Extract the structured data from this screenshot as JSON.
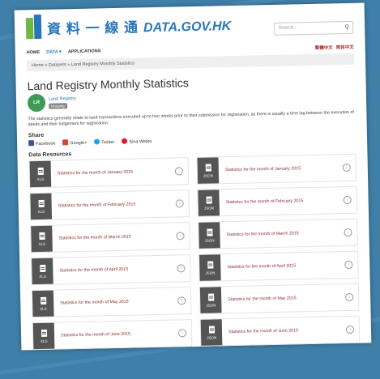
{
  "header": {
    "logo_chinese": "資 料 一 線 通",
    "logo_domain": "DATA.GOV.HK",
    "search_placeholder": "Search..."
  },
  "nav": {
    "items": [
      "HOME",
      "DATA ▾",
      "APPLICATIONS"
    ],
    "languages": [
      "繁體中文",
      "简体中文"
    ]
  },
  "breadcrumb": "Home » Datasets » Land Registry Monthly Statistics",
  "page": {
    "title": "Land Registry Monthly Statistics",
    "org_name": "Land Registry",
    "org_badge": "Housing",
    "org_logo_text": "LR",
    "description": "The statistics generally relate to land transactions executed up to four weeks prior to their submission for registration, as there is usually a time lag between the execution of deeds and their lodgement for registration."
  },
  "share": {
    "heading": "Share",
    "items": [
      {
        "label": "Facebook",
        "color": "#3b5998"
      },
      {
        "label": "Google+",
        "color": "#d34836"
      },
      {
        "label": "Twitter",
        "color": "#1da1f2"
      },
      {
        "label": "Sina Weibo",
        "color": "#e6162d"
      }
    ]
  },
  "resources": {
    "heading": "Data Resources",
    "rows": [
      {
        "xls": "Statistics for the month of January 2015",
        "json": "Statistics for the month of January 2015"
      },
      {
        "xls": "Statistics for the month of February 2015",
        "json": "Statistics for the month of February 2015"
      },
      {
        "xls": "Statistics for the month of March 2015",
        "json": "Statistics for the month of March 2015"
      },
      {
        "xls": "Statistics for the month of April 2015",
        "json": "Statistics for the month of April 2015"
      },
      {
        "xls": "Statistics for the month of May 2015",
        "json": "Statistics for the month of May 2015"
      },
      {
        "xls": "Statistics for the month of June 2015",
        "json": "Statistics for the month of June 2015"
      }
    ],
    "xls_label": "XLS",
    "json_label": "JSON",
    "info_glyph": "i"
  },
  "search_glyph": "⚲"
}
